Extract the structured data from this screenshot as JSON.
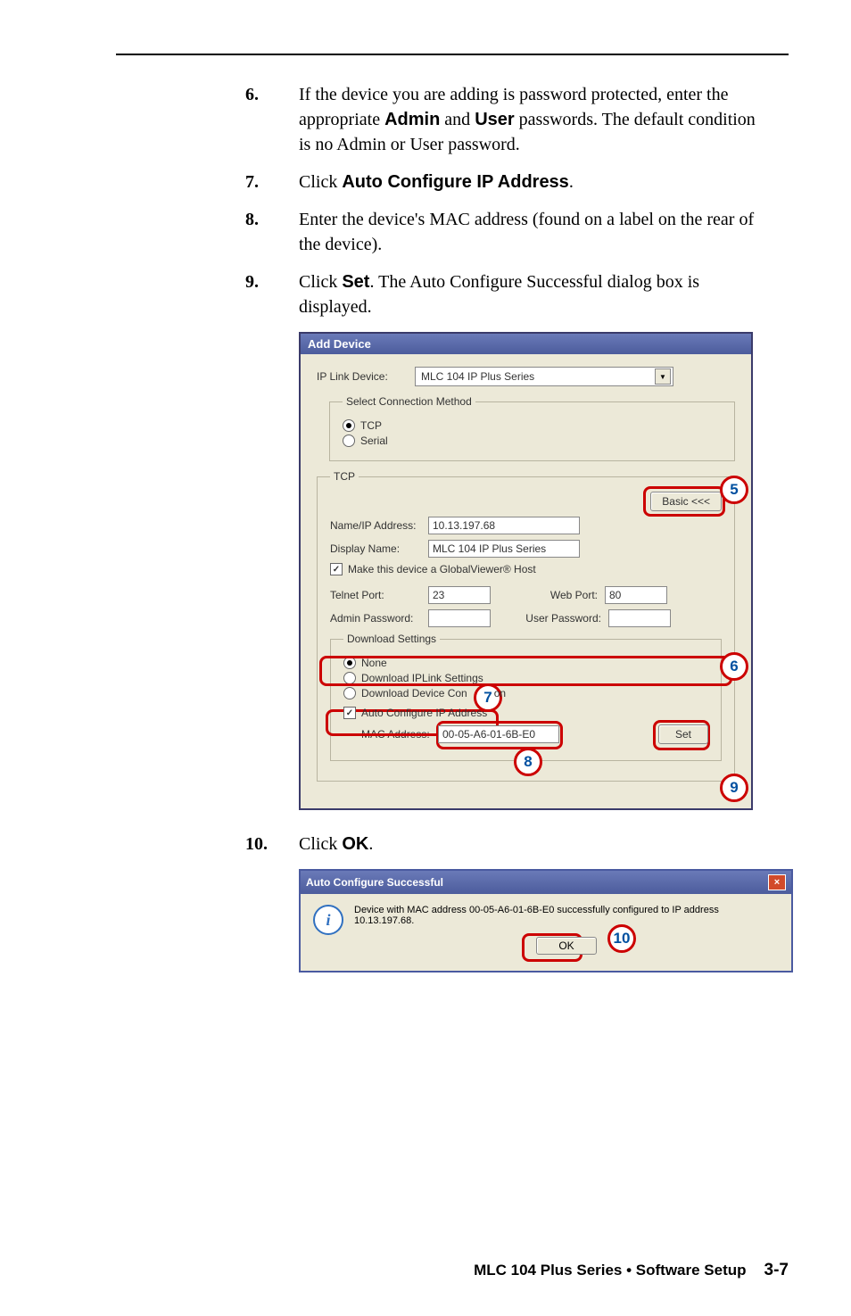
{
  "steps": {
    "s6": {
      "num": "6",
      "text_a": "If the device you are adding is password protected, enter the appropriate ",
      "b1": "Admin",
      "text_b": " and ",
      "b2": "User",
      "text_c": " passwords.  The default condition is no Admin or User password."
    },
    "s7": {
      "num": "7",
      "text_a": "Click ",
      "b1": "Auto Configure IP Address",
      "text_b": "."
    },
    "s8": {
      "num": "8",
      "text_a": "Enter the device's MAC address (found on a label on the rear of the device)."
    },
    "s9": {
      "num": "9",
      "text_a": "Click ",
      "b1": "Set",
      "text_b": ".  The Auto Configure Successful dialog box is displayed."
    },
    "s10": {
      "num": "10",
      "text_a": "Click ",
      "b1": "OK",
      "text_b": "."
    }
  },
  "dialog": {
    "title": "Add Device",
    "iplink_label": "IP Link Device:",
    "iplink_value": "MLC 104 IP Plus Series",
    "scm_legend": "Select Connection Method",
    "scm_tcp": "TCP",
    "scm_serial": "Serial",
    "tcp_legend": "TCP",
    "basic_btn": "Basic <<<",
    "name_label": "Name/IP Address:",
    "name_value": "10.13.197.68",
    "disp_label": "Display Name:",
    "disp_value": "MLC 104 IP Plus Series",
    "gv_check": "Make this device a GlobalViewer® Host",
    "telnet_label": "Telnet Port:",
    "telnet_value": "23",
    "web_label": "Web Port:",
    "web_value": "80",
    "admin_label": "Admin Password:",
    "user_label": "User Password:",
    "dl_legend": "Download Settings",
    "dl_none": "None",
    "dl_iplink": "Download IPLink Settings",
    "dl_devcon_a": "Download Device Con",
    "dl_devcon_b": "on",
    "auto_check": "Auto Configure IP Address",
    "mac_label": "MAC Address:",
    "mac_value": "00-05-A6-01-6B-E0",
    "set_btn": "Set"
  },
  "callouts": {
    "c5": "5",
    "c6": "6",
    "c7": "7",
    "c8": "8",
    "c9": "9",
    "c10": "10"
  },
  "success": {
    "title": "Auto Configure Successful",
    "msg": "Device with MAC address 00-05-A6-01-6B-E0 successfully configured to IP address 10.13.197.68.",
    "ok": "OK"
  },
  "footer": {
    "title": "MLC 104 Plus Series • Software Setup",
    "page": "3-7"
  }
}
